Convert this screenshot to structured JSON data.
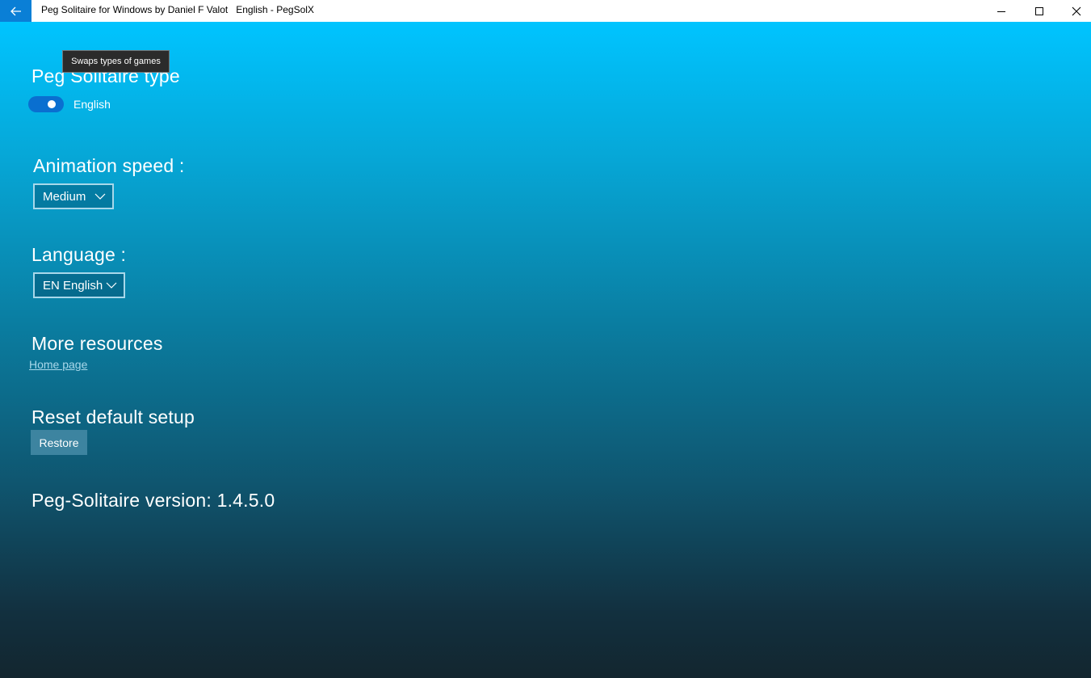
{
  "titlebar": {
    "title": "Peg Solitaire for Windows by Daniel F Valot   English - PegSolX",
    "back_icon": "arrow-left-icon",
    "minimize_icon": "minimize-icon",
    "maximize_icon": "maximize-icon",
    "close_icon": "close-icon"
  },
  "tooltip": {
    "text": "Swaps types of games"
  },
  "type_section": {
    "heading": "Peg Solitaire type",
    "toggle_on": true,
    "toggle_label": "English"
  },
  "animation_section": {
    "heading": "Animation speed :",
    "selected": "Medium"
  },
  "language_section": {
    "heading": "Language :",
    "selected": "EN English"
  },
  "resources_section": {
    "heading": "More resources",
    "link_label": "Home page"
  },
  "reset_section": {
    "heading": "Reset default setup",
    "button_label": "Restore"
  },
  "version": {
    "text": "Peg-Solitaire version: 1.4.5.0"
  },
  "colors": {
    "accent": "#0a7fd6",
    "gradient_top": "#00c4ff",
    "gradient_bottom": "#13262f",
    "link": "#a8d8ea",
    "button": "#3d84a0"
  }
}
